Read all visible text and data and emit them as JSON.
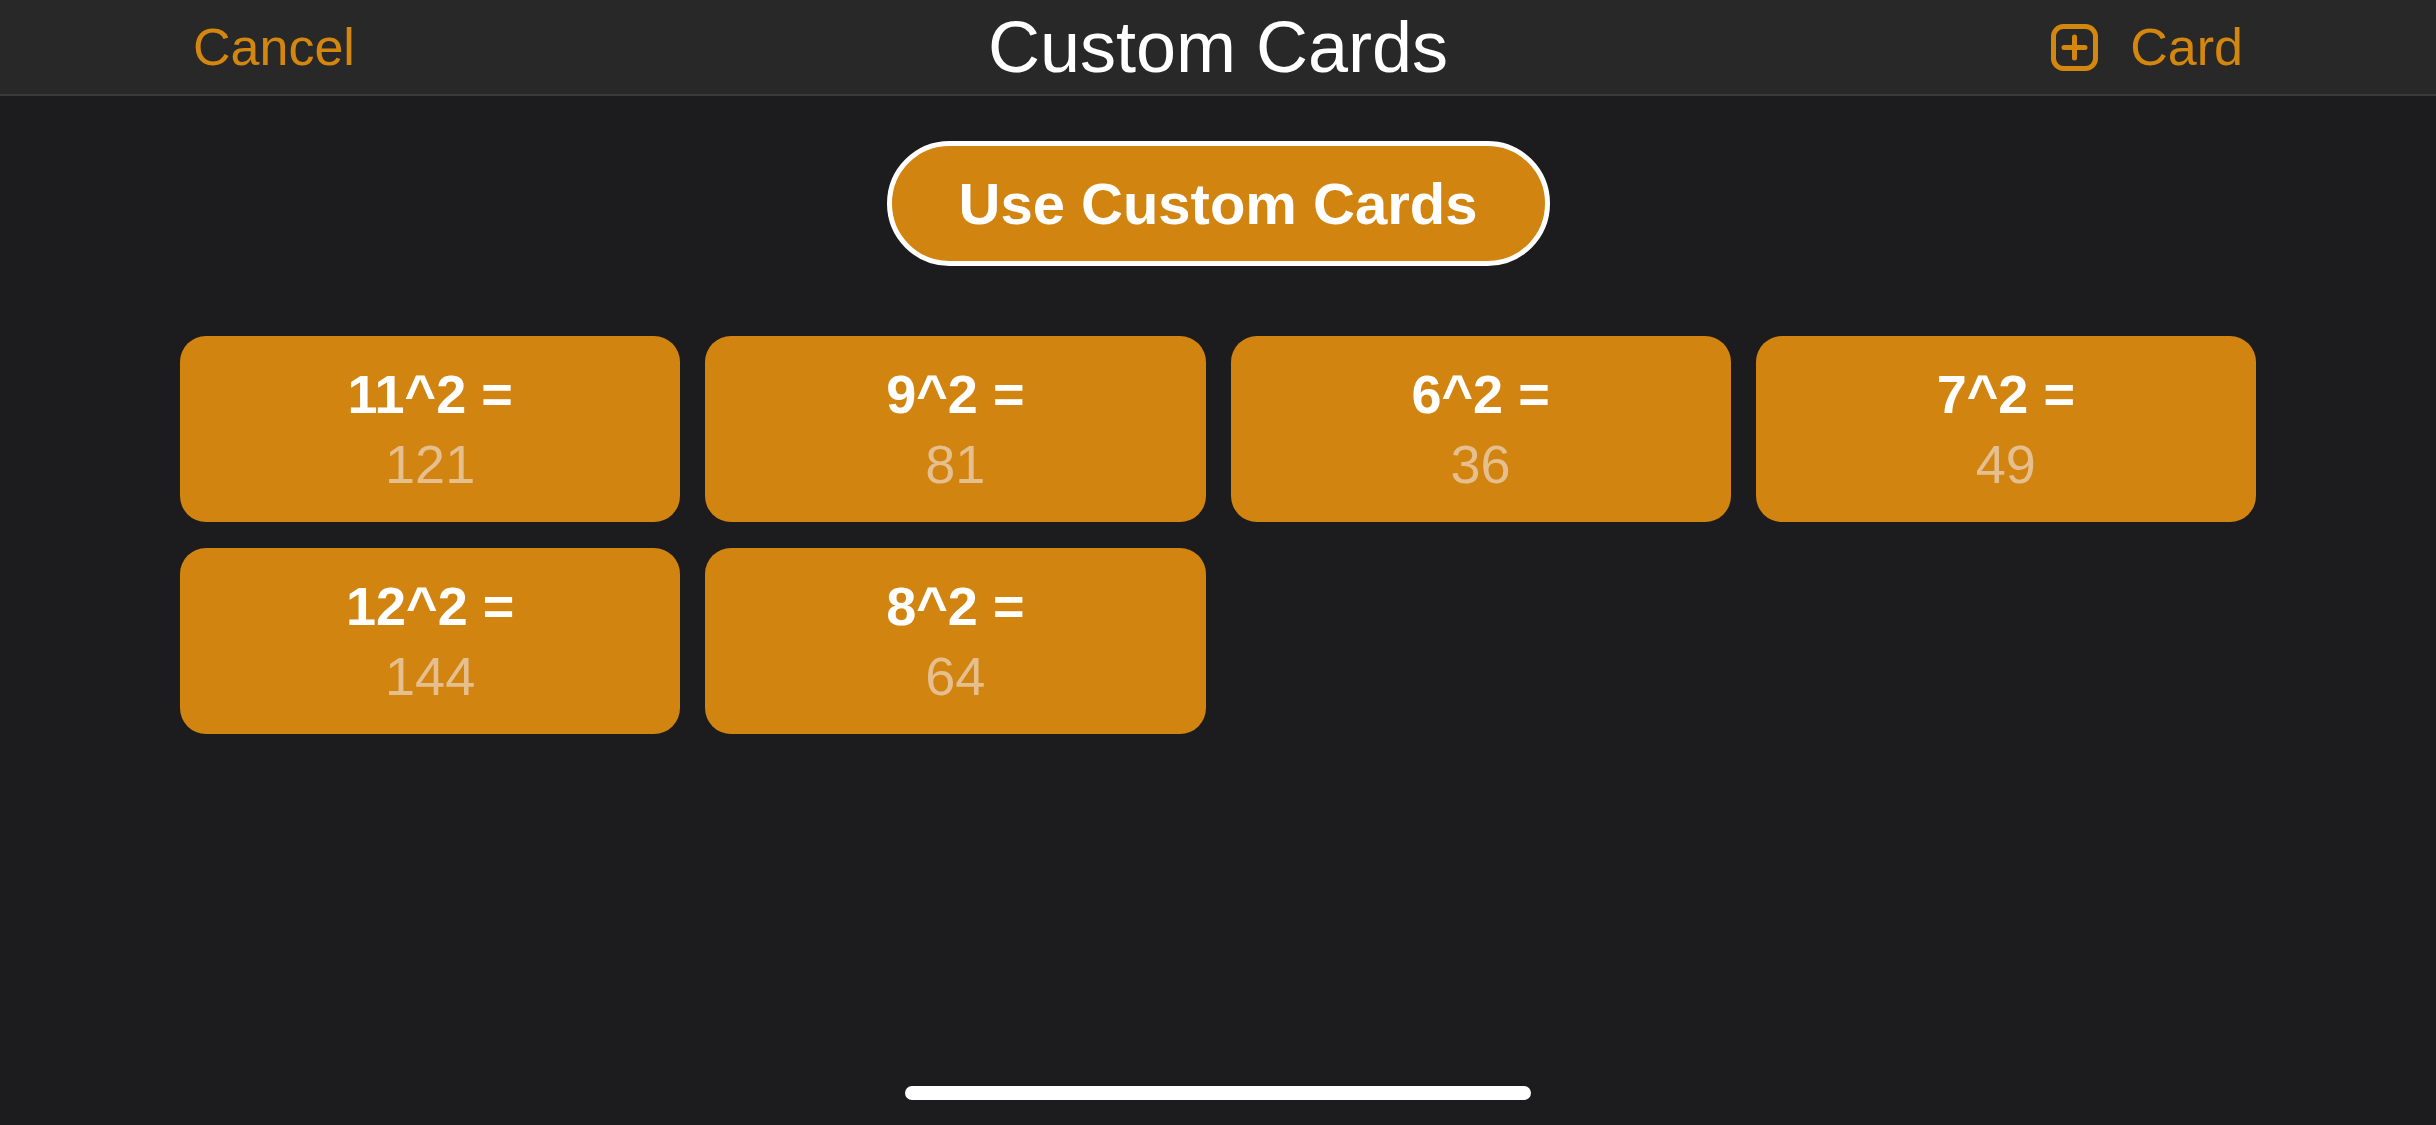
{
  "nav_bar": {
    "cancel": "Cancel",
    "title": "Custom Cards",
    "add_button": "Card"
  },
  "toggle_button": {
    "label": "Use Custom Cards"
  },
  "cards": [
    {
      "question": "11^2 =",
      "answer": "121"
    },
    {
      "question": "9^2 =",
      "answer": "81"
    },
    {
      "question": "6^2 =",
      "answer": "36"
    },
    {
      "question": "7^2 =",
      "answer": "49"
    },
    {
      "question": "12^2 =",
      "answer": "144"
    },
    {
      "question": "8^2 =",
      "answer": "64"
    }
  ]
}
